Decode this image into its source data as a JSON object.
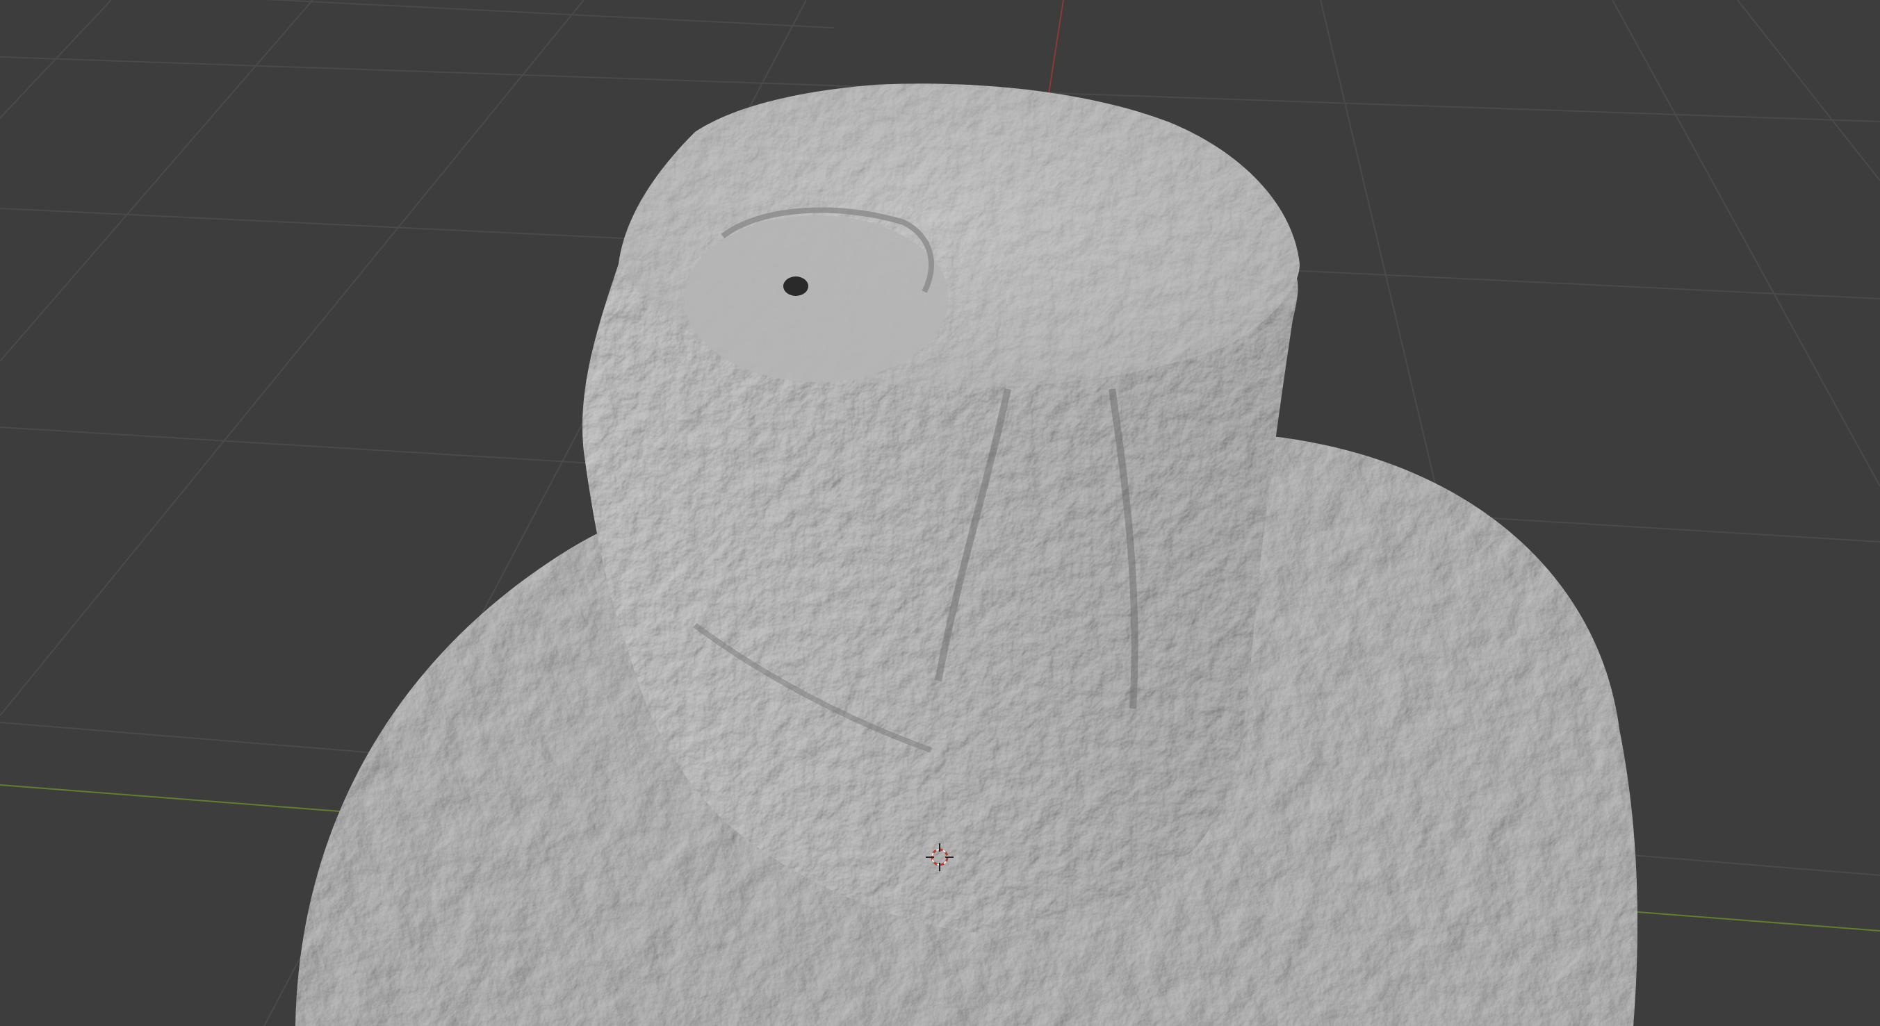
{
  "viewport": {
    "background_color": "#3d3d3d",
    "grid_color": "#4a4a4a",
    "x_axis_color": "#8b3a3a",
    "y_axis_color": "#5f7f2e",
    "mesh_color": "#9a9a9a",
    "cursor_name": "3d-cursor-icon"
  }
}
